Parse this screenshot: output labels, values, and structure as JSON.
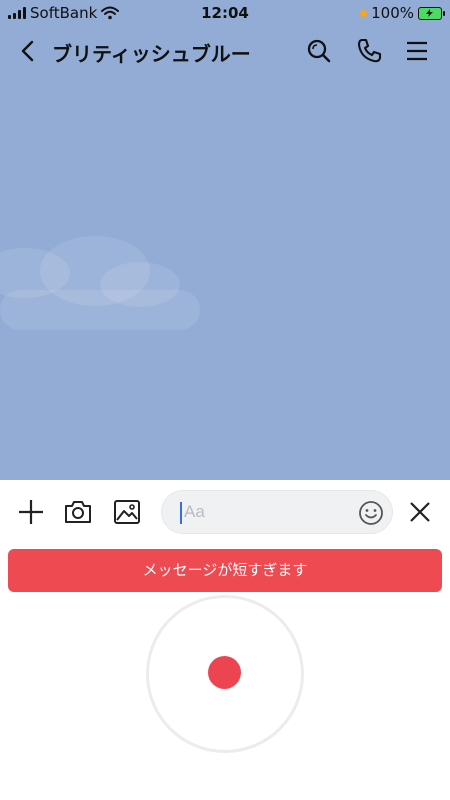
{
  "status_bar": {
    "carrier": "SoftBank",
    "time": "12:04",
    "battery": "100%"
  },
  "header": {
    "title": "ブリティッシュブルー",
    "icons": [
      "back-icon",
      "search-icon",
      "phone-icon",
      "menu-icon"
    ]
  },
  "composer": {
    "placeholder": "Aa",
    "icons": [
      "plus-icon",
      "camera-icon",
      "image-icon",
      "emoji-icon",
      "close-icon"
    ]
  },
  "toast": {
    "message": "メッセージが短すぎます"
  },
  "colors": {
    "chat_background": "#92acd6",
    "toast": "#ee4a52",
    "record_dot": "#ec4551"
  }
}
